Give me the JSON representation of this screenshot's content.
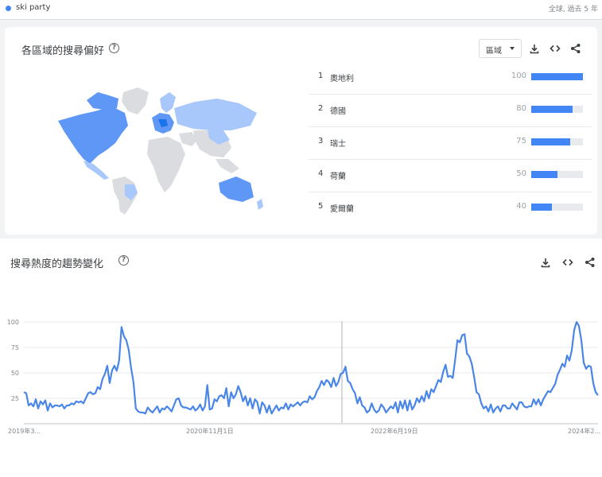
{
  "header": {
    "term": "ski party",
    "scope": "全球, 過去 5 年"
  },
  "region_card": {
    "title": "各區域的搜尋偏好",
    "help": "?",
    "select_value": "區域",
    "rows": [
      {
        "rank": "1",
        "name": "奧地利",
        "value": 100
      },
      {
        "rank": "2",
        "name": "德國",
        "value": 80
      },
      {
        "rank": "3",
        "name": "瑞士",
        "value": 75
      },
      {
        "rank": "4",
        "name": "荷蘭",
        "value": 50
      },
      {
        "rank": "5",
        "name": "愛爾蘭",
        "value": 40
      }
    ],
    "colors": {
      "bar": "#4285f4",
      "track": "#e8eaed",
      "map_high": "#1a73e8",
      "map_mid": "#5e97f6",
      "map_low": "#a8c7fa",
      "map_none": "#dadce0"
    }
  },
  "trend_card": {
    "title": "搜尋熱度的趨勢變化",
    "help": "?"
  },
  "chart_data": {
    "type": "line",
    "ylim": [
      0,
      100
    ],
    "yticks": [
      "100",
      "75",
      "50",
      "25"
    ],
    "xtick_labels": [
      "2019年3...",
      "2020年11月1日",
      "2022年6月19日",
      "2024年2..."
    ],
    "series": [
      {
        "values": [
          31,
          30,
          18,
          20,
          17,
          24,
          15,
          22,
          19,
          23,
          13,
          20,
          16,
          18,
          18,
          17,
          19,
          15,
          18,
          18,
          20,
          19,
          22,
          21,
          22,
          20,
          25,
          30,
          31,
          29,
          30,
          36,
          34,
          44,
          49,
          57,
          40,
          52,
          57,
          52,
          62,
          95,
          86,
          82,
          73,
          55,
          41,
          15,
          12,
          11,
          11,
          10,
          16,
          13,
          11,
          14,
          17,
          11,
          15,
          14,
          17,
          15,
          12,
          18,
          24,
          25,
          18,
          16,
          16,
          15,
          14,
          17,
          13,
          15,
          19,
          13,
          17,
          38,
          14,
          15,
          24,
          22,
          27,
          28,
          25,
          35,
          17,
          31,
          25,
          29,
          37,
          31,
          22,
          27,
          18,
          25,
          15,
          24,
          21,
          10,
          21,
          18,
          11,
          18,
          10,
          14,
          18,
          13,
          16,
          15,
          20,
          14,
          19,
          17,
          19,
          21,
          18,
          21,
          22,
          21,
          27,
          24,
          26,
          32,
          36,
          42,
          38,
          43,
          41,
          36,
          45,
          37,
          41,
          49,
          50,
          56,
          42,
          40,
          34,
          30,
          20,
          26,
          18,
          16,
          11,
          13,
          20,
          14,
          11,
          13,
          19,
          16,
          11,
          14,
          17,
          15,
          21,
          11,
          22,
          15,
          23,
          13,
          23,
          14,
          18,
          25,
          21,
          27,
          22,
          32,
          25,
          34,
          31,
          37,
          43,
          41,
          51,
          58,
          46,
          47,
          45,
          62,
          82,
          80,
          87,
          88,
          69,
          66,
          59,
          46,
          31,
          29,
          20,
          15,
          17,
          12,
          19,
          11,
          15,
          17,
          12,
          18,
          18,
          15,
          15,
          20,
          17,
          14,
          21,
          21,
          17,
          16,
          17,
          17,
          24,
          19,
          24,
          18,
          24,
          28,
          32,
          31,
          35,
          39,
          48,
          53,
          59,
          56,
          67,
          62,
          72,
          92,
          100,
          96,
          82,
          60,
          54,
          57,
          56,
          40,
          31,
          28
        ]
      }
    ]
  }
}
